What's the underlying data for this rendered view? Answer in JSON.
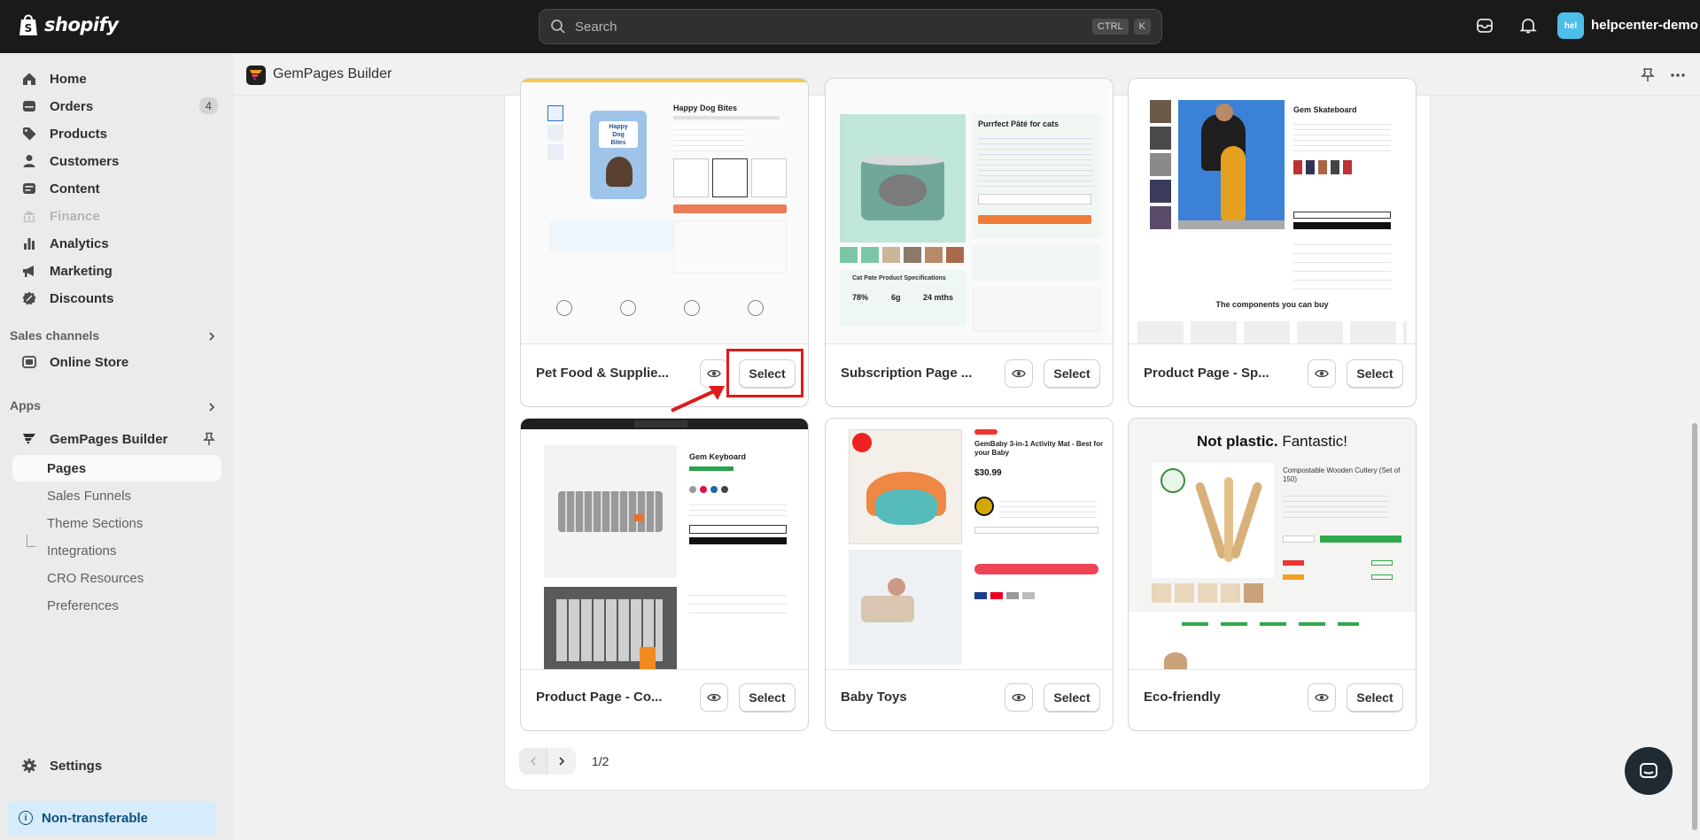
{
  "topbar": {
    "brand": "shopify",
    "search_placeholder": "Search",
    "shortcut_ctrl": "CTRL",
    "shortcut_k": "K",
    "store_initials": "hel",
    "store_name": "helpcenter-demo"
  },
  "sidebar": {
    "items": [
      {
        "label": "Home",
        "icon": "home-icon"
      },
      {
        "label": "Orders",
        "icon": "orders-icon",
        "badge": "4"
      },
      {
        "label": "Products",
        "icon": "tag-icon"
      },
      {
        "label": "Customers",
        "icon": "person-icon"
      },
      {
        "label": "Content",
        "icon": "content-icon"
      },
      {
        "label": "Finance",
        "icon": "finance-icon",
        "disabled": true
      },
      {
        "label": "Analytics",
        "icon": "analytics-icon"
      },
      {
        "label": "Marketing",
        "icon": "marketing-icon"
      },
      {
        "label": "Discounts",
        "icon": "discount-icon"
      }
    ],
    "sales_channels_heading": "Sales channels",
    "online_store": "Online Store",
    "apps_heading": "Apps",
    "app_name": "GemPages Builder",
    "app_sub_items": [
      "Pages",
      "Sales Funnels",
      "Theme Sections",
      "Integrations",
      "CRO Resources",
      "Preferences"
    ],
    "settings": "Settings",
    "non_transferable": "Non-transferable"
  },
  "app_header": {
    "title": "GemPages Builder"
  },
  "templates": [
    {
      "name": "Pet Food & Supplie...",
      "select_label": "Select",
      "preview_title": "Happy Dog Bites"
    },
    {
      "name": "Subscription Page ...",
      "select_label": "Select",
      "preview_title": "Purrfect Pâté for cats",
      "preview_sub": "Cat Pate Product Specifications",
      "stats": [
        "78%",
        "6g",
        "24 mths"
      ]
    },
    {
      "name": "Product Page - Sp...",
      "select_label": "Select",
      "preview_title": "Gem Skateboard",
      "preview_footer": "The components you can buy"
    },
    {
      "name": "Product Page - Co...",
      "select_label": "Select",
      "preview_title": "Gem Keyboard"
    },
    {
      "name": "Baby Toys",
      "select_label": "Select",
      "preview_title": "GemBaby 3-in-1 Activity Mat - Best for your Baby",
      "preview_price": "$30.99"
    },
    {
      "name": "Eco-friendly",
      "select_label": "Select",
      "preview_title_bold": "Not plastic.",
      "preview_title_rest": "Fantastic!",
      "preview_sub": "Compostable Wooden Cutlery (Set of 150)"
    }
  ],
  "pagination": {
    "text": "1/2"
  }
}
